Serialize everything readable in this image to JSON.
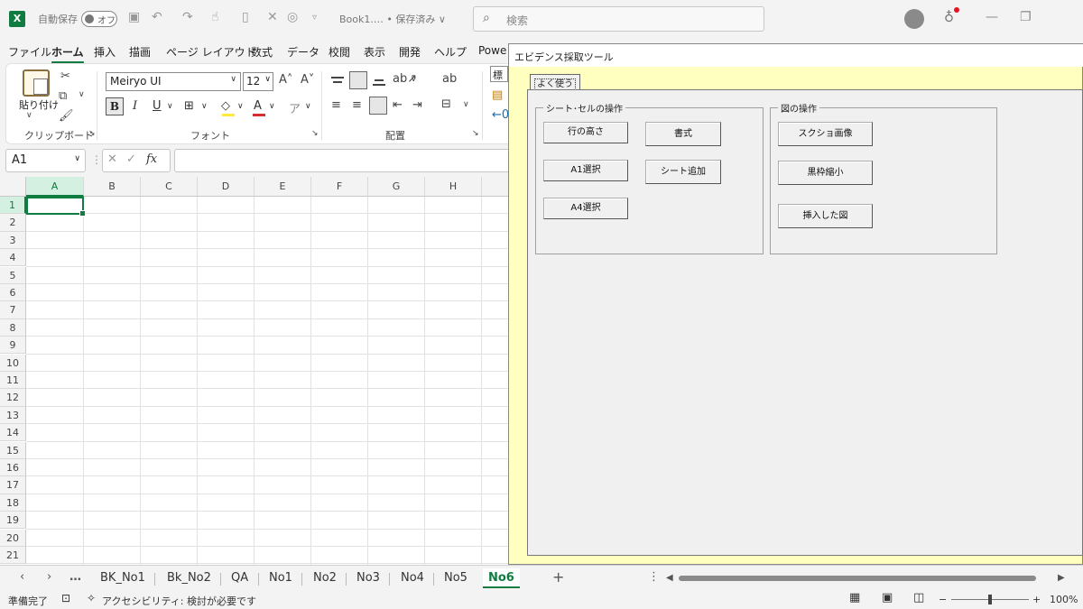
{
  "titlebar": {
    "logo": "X",
    "autosave_label": "自動保存",
    "autosave_state": "オフ",
    "book_title": "Book1.… • 保存済み ∨",
    "search_placeholder": "検索"
  },
  "ribbon_tabs": [
    "ファイル",
    "ホーム",
    "挿入",
    "描画",
    "ページ レイアウト",
    "数式",
    "データ",
    "校閲",
    "表示",
    "開発",
    "ヘルプ",
    "Powe"
  ],
  "active_ribbon_tab": "ホーム",
  "ribbon": {
    "paste_label": "貼り付け",
    "clipboard_group": "クリップボード",
    "font_group": "フォント",
    "align_group": "配置",
    "font_name": "Meiryo UI",
    "font_size": "12",
    "number_format_partial": "標準"
  },
  "formula_bar": {
    "name_box": "A1",
    "fx": "fx",
    "value": ""
  },
  "grid": {
    "columns": [
      "A",
      "B",
      "C",
      "D",
      "E",
      "F",
      "G",
      "H"
    ],
    "rows": [
      "1",
      "2",
      "3",
      "4",
      "5",
      "6",
      "7",
      "8",
      "9",
      "10",
      "11",
      "12",
      "13",
      "14",
      "15",
      "16",
      "17",
      "18",
      "19",
      "20",
      "21"
    ],
    "active_cell": "A1"
  },
  "sheets": {
    "more": "…",
    "tabs": [
      "BK_No1",
      "Bk_No2",
      "QA",
      "No1",
      "No2",
      "No3",
      "No4",
      "No5",
      "No6"
    ],
    "active": "No6",
    "add": "+"
  },
  "status": {
    "ready": "準備完了",
    "accessibility": "アクセシビリティ: 検討が必要です",
    "zoom": "100%"
  },
  "tool_window": {
    "title": "エビデンス採取ツール",
    "tab": "よく使う",
    "group_sheet": {
      "legend": "シート･セルの操作",
      "buttons": [
        "行の高さ",
        "書式",
        "A1選択",
        "シート追加",
        "A4選択"
      ]
    },
    "group_figure": {
      "legend": "図の操作",
      "buttons": [
        "スクショ画像",
        "黒枠縮小",
        "挿入した図"
      ]
    }
  },
  "colors": {
    "excel_green": "#107c41",
    "tool_bg": "#ffffc0",
    "dialog_bg": "#f0f0f0"
  }
}
